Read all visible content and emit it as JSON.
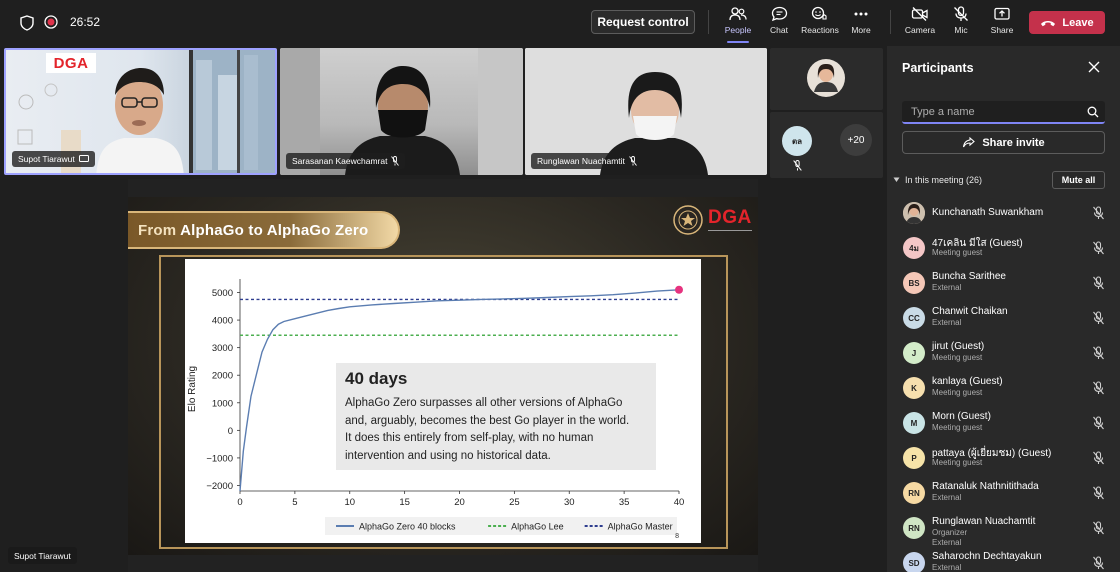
{
  "topbar": {
    "timer": "26:52",
    "request_control_label": "Request control",
    "tools": {
      "people": "People",
      "chat": "Chat",
      "reactions": "Reactions",
      "more": "More",
      "camera": "Camera",
      "mic": "Mic",
      "share": "Share"
    },
    "leave_label": "Leave"
  },
  "videos": {
    "speaker_name": "Supot Tiarawut",
    "speaker_logo": "DGA",
    "tile2_name": "Sarasanan Kaewchamrat",
    "tile3_name": "Runglawan Nuachamtit",
    "mini_avatar_initials": "ตล",
    "overflow_count": "+20",
    "bottom_name_tag": "Supot Tiarawut"
  },
  "slide": {
    "title_prefix": "From ",
    "title_main": "AlphaGo to AlphaGo Zero",
    "logo_text": "DGA",
    "page_number": "8",
    "callout_heading": "40 days",
    "callout_lines": [
      "AlphaGo Zero surpasses all other versions of AlphaGo",
      "and, arguably, becomes the best Go player in the world.",
      "It does this entirely from self-play, with no human",
      "intervention and using no historical data."
    ]
  },
  "chart_data": {
    "type": "line",
    "title": "",
    "xlabel": "",
    "ylabel": "Elo Rating",
    "xlim": [
      0,
      40
    ],
    "ylim": [
      -2200,
      5200
    ],
    "x_ticks": [
      0,
      5,
      10,
      15,
      20,
      25,
      30,
      35,
      40
    ],
    "y_ticks": [
      -2000,
      -1000,
      0,
      1000,
      2000,
      3000,
      4000,
      5000
    ],
    "series": [
      {
        "name": "AlphaGo Zero 40 blocks",
        "color": "#5b7db1",
        "style": "solid",
        "x": [
          0,
          0.3,
          0.6,
          1,
          1.5,
          2,
          2.5,
          3,
          3.5,
          4,
          5,
          6,
          7,
          8,
          9,
          10,
          12,
          14,
          16,
          18,
          20,
          22,
          24,
          26,
          28,
          30,
          32,
          34,
          36,
          38,
          40
        ],
        "y": [
          -2200,
          -800,
          200,
          1200,
          2100,
          2800,
          3300,
          3650,
          3850,
          3950,
          4050,
          4150,
          4250,
          4350,
          4420,
          4480,
          4550,
          4600,
          4650,
          4700,
          4720,
          4750,
          4770,
          4790,
          4820,
          4850,
          4880,
          4920,
          4980,
          5050,
          5100
        ]
      },
      {
        "name": "AlphaGo Lee",
        "color": "#4caf50",
        "style": "dashed",
        "value": 3450
      },
      {
        "name": "AlphaGo Master",
        "color": "#2e3d8f",
        "style": "dashed",
        "value": 4750
      }
    ],
    "endpoint_marker_color": "#e6337f",
    "legend_position": "bottom-right"
  },
  "panel": {
    "title": "Participants",
    "search_placeholder": "Type a name",
    "share_invite_label": "Share invite",
    "in_meeting_label": "In this meeting (26)",
    "mute_all_label": "Mute all",
    "participants": [
      {
        "initials": "",
        "name": "Kunchanath Suwankham",
        "sub": "",
        "avatar_color": "#c9b8a8",
        "photo": true
      },
      {
        "initials": "4ม",
        "name": "47เคลิน มีใส (Guest)",
        "sub": "Meeting guest",
        "avatar_color": "#f3c6c6"
      },
      {
        "initials": "BS",
        "name": "Buncha Sarithee",
        "sub": "External",
        "avatar_color": "#f4c7b7"
      },
      {
        "initials": "CC",
        "name": "Chanwit Chaikan",
        "sub": "External",
        "avatar_color": "#c9dbe6"
      },
      {
        "initials": "J",
        "name": "jirut (Guest)",
        "sub": "Meeting guest",
        "avatar_color": "#d3ecc9"
      },
      {
        "initials": "K",
        "name": "kanlaya (Guest)",
        "sub": "Meeting guest",
        "avatar_color": "#f6dfae"
      },
      {
        "initials": "M",
        "name": "Morn (Guest)",
        "sub": "Meeting guest",
        "avatar_color": "#c9e4e6"
      },
      {
        "initials": "P",
        "name": "pattaya (ผู้เยี่ยมชม) (Guest)",
        "sub": "Meeting guest",
        "avatar_color": "#f6e3a8"
      },
      {
        "initials": "RN",
        "name": "Ratanaluk Nathnitithada",
        "sub": "External",
        "avatar_color": "#f6d9a3"
      },
      {
        "initials": "RN",
        "name": "Runglawan Nuachamtit",
        "sub": "Organizer",
        "sub2": "External",
        "avatar_color": "#cfe5c4"
      },
      {
        "initials": "SD",
        "name": "Saharochn Dechtayakun",
        "sub": "External",
        "avatar_color": "#c8d6ee"
      }
    ]
  }
}
